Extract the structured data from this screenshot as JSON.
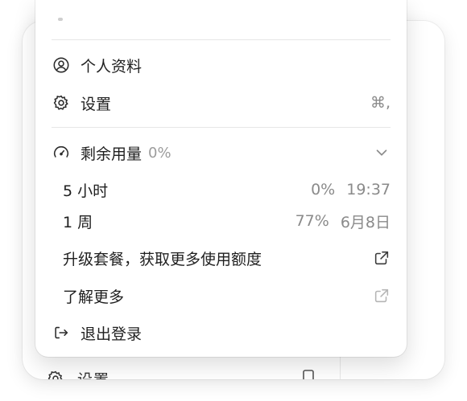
{
  "background": {
    "settings_label": "设置"
  },
  "menu": {
    "profile": {
      "label": "个人资料",
      "icon": "user-circle-icon"
    },
    "settings": {
      "label": "设置",
      "icon": "gear-icon",
      "shortcut": "⌘,"
    },
    "usage": {
      "label": "剩余用量",
      "percent": "0%",
      "icon": "gauge-icon",
      "items": [
        {
          "label": "5 小时",
          "percent": "0%",
          "reset": "19:37"
        },
        {
          "label": "1 周",
          "percent": "77%",
          "reset": "6月8日"
        }
      ]
    },
    "upgrade": {
      "label": "升级套餐，获取更多使用额度",
      "icon": "external-link-icon"
    },
    "learn_more": {
      "label": "了解更多",
      "icon": "external-link-icon"
    },
    "logout": {
      "label": "退出登录",
      "icon": "logout-icon"
    }
  }
}
